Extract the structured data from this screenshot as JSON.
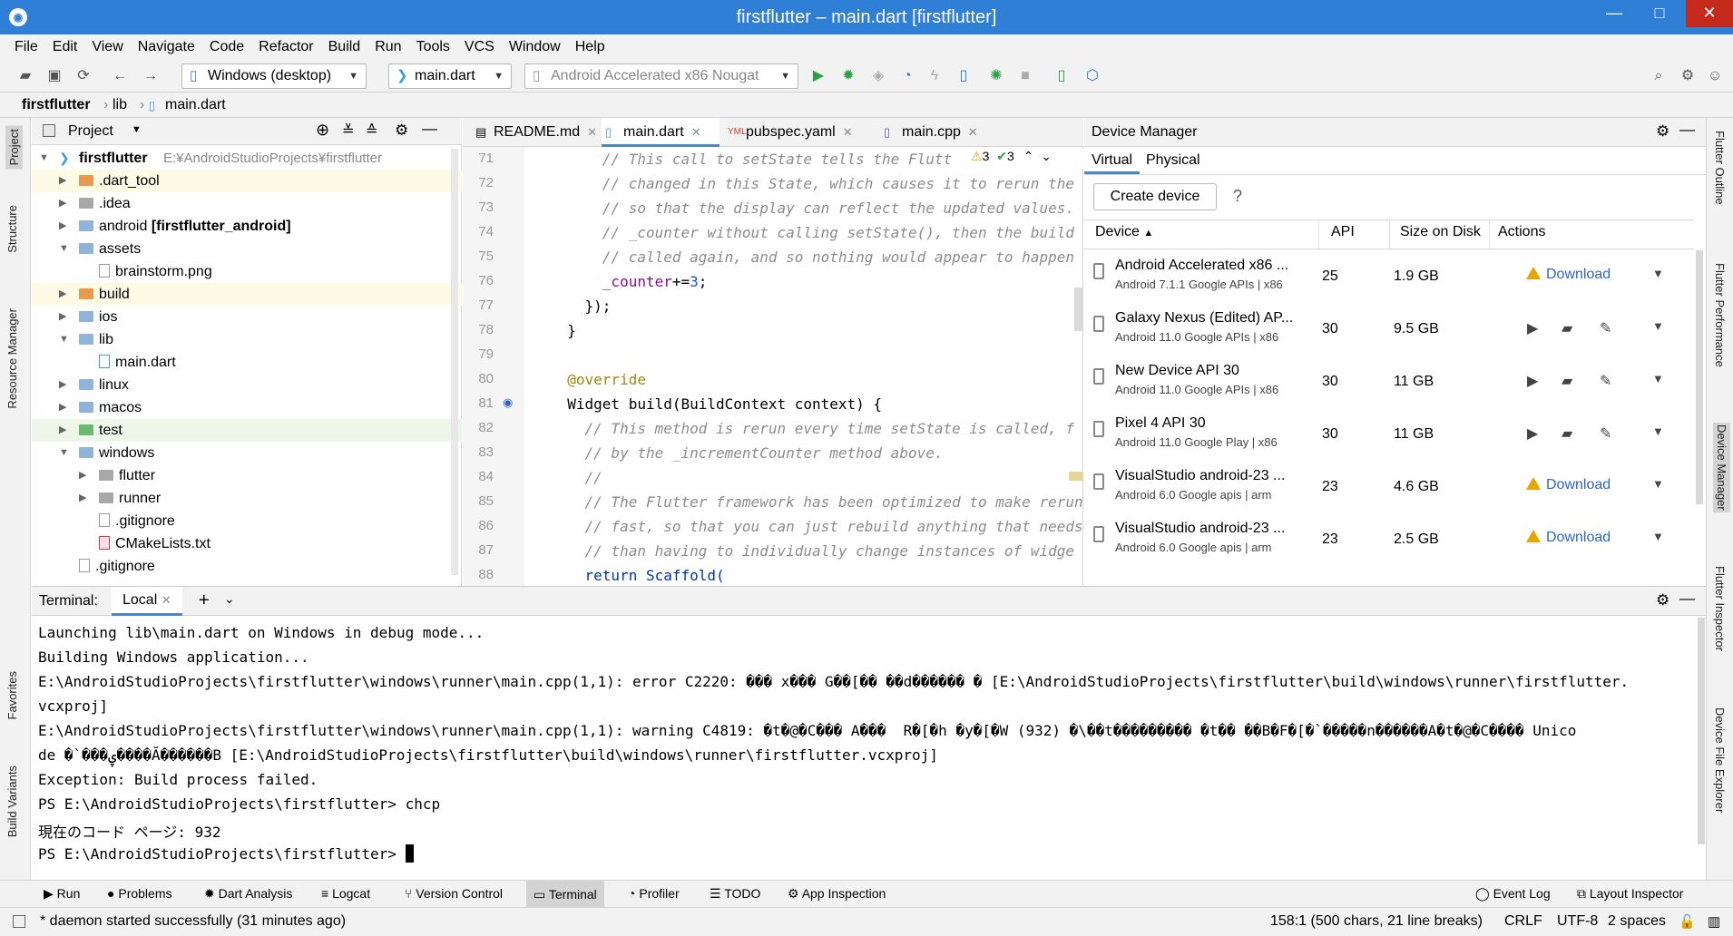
{
  "window": {
    "title": "firstflutter – main.dart [firstflutter]",
    "minimize": "—",
    "maximize": "□",
    "close": "✕"
  },
  "menu": [
    "File",
    "Edit",
    "View",
    "Navigate",
    "Code",
    "Refactor",
    "Build",
    "Run",
    "Tools",
    "VCS",
    "Window",
    "Help"
  ],
  "toolbar": {
    "device_target": "Windows (desktop)",
    "run_config": "main.dart",
    "emulator": "Android Accelerated x86 Nougat"
  },
  "breadcrumb": [
    "firstflutter",
    "lib",
    "main.dart"
  ],
  "left_strip": [
    "Project",
    "Structure",
    "Resource Manager",
    "Favorites",
    "Build Variants"
  ],
  "right_strip": [
    "Flutter Outline",
    "Flutter Performance",
    "Device Manager",
    "Flutter Inspector",
    "Device File Explorer"
  ],
  "project": {
    "header": "Project",
    "root": {
      "name": "firstflutter",
      "path": "E:¥AndroidStudioProjects¥firstflutter"
    },
    "items": [
      {
        "label": ".dart_tool",
        "bold": ""
      },
      {
        "label": ".idea",
        "bold": ""
      },
      {
        "label": "android",
        "bold": "[firstflutter_android]"
      },
      {
        "label": "assets",
        "bold": ""
      },
      {
        "label": "brainstorm.png",
        "bold": ""
      },
      {
        "label": "build",
        "bold": ""
      },
      {
        "label": "ios",
        "bold": ""
      },
      {
        "label": "lib",
        "bold": ""
      },
      {
        "label": "main.dart",
        "bold": ""
      },
      {
        "label": "linux",
        "bold": ""
      },
      {
        "label": "macos",
        "bold": ""
      },
      {
        "label": "test",
        "bold": ""
      },
      {
        "label": "windows",
        "bold": ""
      },
      {
        "label": "flutter",
        "bold": ""
      },
      {
        "label": "runner",
        "bold": ""
      },
      {
        "label": ".gitignore",
        "bold": ""
      },
      {
        "label": "CMakeLists.txt",
        "bold": ""
      },
      {
        "label": ".gitignore",
        "bold": ""
      }
    ]
  },
  "editor": {
    "tabs": [
      "README.md",
      "main.dart",
      "pubspec.yaml",
      "main.cpp"
    ],
    "inspection": {
      "warnings": "3",
      "checks": "3"
    },
    "line_numbers": [
      "71",
      "72",
      "73",
      "74",
      "75",
      "76",
      "77",
      "78",
      "79",
      "80",
      "81",
      "82",
      "83",
      "84",
      "85",
      "86",
      "87",
      "88"
    ],
    "code": [
      "      // This call to setState tells the Flutt",
      "      // changed in this State, which causes it to rerun the",
      "      // so that the display can reflect the updated values.",
      "      // _counter without calling setState(), then the build",
      "      // called again, and so nothing would appear to happen",
      "      _counter",
      "    });",
      "  }",
      "",
      "  @override",
      "  Widget build(BuildContext context) {",
      "    // This method is rerun every time setState is called, f",
      "    // by the _incrementCounter method above.",
      "    //",
      "    // The Flutter framework has been optimized to make rerun",
      "    // fast, so that you can just rebuild anything that needs",
      "    // than having to individually change instances of widge",
      "    return Scaffold("
    ],
    "code_counter_suffix": "+=",
    "code_counter_value": "3",
    "code_counter_end": ";"
  },
  "device_manager": {
    "title": "Device Manager",
    "tabs": [
      "Virtual",
      "Physical"
    ],
    "create_button": "Create device",
    "help": "?",
    "columns": [
      "Device",
      "API",
      "Size on Disk",
      "Actions"
    ],
    "devices": [
      {
        "name": "Android Accelerated x86 ...",
        "sub": "Android 7.1.1 Google APIs | x86",
        "api": "25",
        "size": "1.9 GB",
        "action": "Download"
      },
      {
        "name": "Galaxy Nexus (Edited) AP...",
        "sub": "Android 11.0 Google APIs | x86",
        "api": "30",
        "size": "9.5 GB",
        "action": ""
      },
      {
        "name": "New Device API 30",
        "sub": "Android 11.0 Google APIs | x86",
        "api": "30",
        "size": "11 GB",
        "action": ""
      },
      {
        "name": "Pixel 4 API 30",
        "sub": "Android 11.0 Google Play | x86",
        "api": "30",
        "size": "11 GB",
        "action": ""
      },
      {
        "name": "VisualStudio android-23 ...",
        "sub": "Android 6.0 Google apis | arm",
        "api": "23",
        "size": "4.6 GB",
        "action": "Download"
      },
      {
        "name": "VisualStudio android-23 ...",
        "sub": "Android 6.0 Google apis | arm",
        "api": "23",
        "size": "2.5 GB",
        "action": "Download"
      }
    ]
  },
  "terminal": {
    "label": "Terminal:",
    "tab": "Local",
    "lines": [
      "Launching lib\\main.dart on Windows in debug mode...",
      "Building Windows application...",
      "E:\\AndroidStudioProjects\\firstflutter\\windows\\runner\\main.cpp(1,1): error C2220: ��� x��� G��[�� ��d������ � [E:\\AndroidStudioProjects\\firstflutter\\build\\windows\\runner\\firstflutter.",
      "vcxproj]",
      "E:\\AndroidStudioProjects\\firstflutter\\windows\\runner\\main.cpp(1,1): warning C4819: �t�@�C��� A���  R�[�h �y�[�W (932) �\\��t��������� �t�� ��B�F�[�`�����n������A�t�@�C���� Unico",
      "de �`���ۑ����Ă������B [E:\\AndroidStudioProjects\\firstflutter\\build\\windows\\runner\\firstflutter.vcxproj]",
      "Exception: Build process failed.",
      "PS E:\\AndroidStudioProjects\\firstflutter> chcp",
      "現在のコード ページ: 932",
      "PS E:\\AndroidStudioProjects\\firstflutter> "
    ]
  },
  "bottom_tools": [
    "Run",
    "Problems",
    "Dart Analysis",
    "Logcat",
    "Version Control",
    "Terminal",
    "Profiler",
    "TODO",
    "App Inspection",
    "Event Log",
    "Layout Inspector"
  ],
  "status": {
    "message": "* daemon started successfully (31 minutes ago)",
    "position": "158:1 (500 chars, 21 line breaks)",
    "line_sep": "CRLF",
    "encoding": "UTF-8",
    "indent": "2 spaces"
  },
  "colors": {
    "titlebar": "#2f7fd6",
    "accent": "#4a88c7",
    "warning": "#e8a600",
    "link": "#2f65ca"
  }
}
